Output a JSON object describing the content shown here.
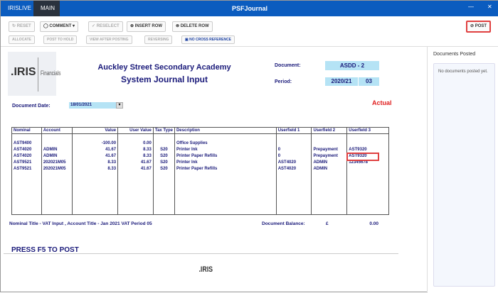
{
  "window": {
    "title": "PSFJournal",
    "tabs": [
      "IRISLIVE",
      "MAIN"
    ],
    "minimize": "—",
    "close": "✕"
  },
  "toolbar": {
    "row1": [
      {
        "label": "RESET",
        "icon": "reset-icon",
        "enabled": false
      },
      {
        "label": "COMMENT",
        "icon": "comment-icon",
        "enabled": true
      },
      {
        "label": "RESELECT",
        "icon": "reselect-icon",
        "enabled": false
      },
      {
        "label": "INSERT ROW",
        "icon": "plus-circle-icon",
        "enabled": true
      },
      {
        "label": "DELETE ROW",
        "icon": "x-circle-icon",
        "enabled": true
      }
    ],
    "row2": [
      {
        "label": "ALLOCATE",
        "enabled": false
      },
      {
        "label": "POST TO HOLD",
        "enabled": false
      },
      {
        "label": "VIEW AFTER POSTING",
        "enabled": false
      },
      {
        "label": "REVERSING",
        "enabled": false
      },
      {
        "label": "NO CROSS REFERENCE",
        "enabled": true
      }
    ],
    "post": "POST"
  },
  "header": {
    "org": "Auckley Street Secondary Academy",
    "title": "System Journal Input",
    "logo": "IRIS Financials",
    "document_label": "Document:",
    "document": "ASDD - 2",
    "period_label": "Period:",
    "period_year": "2020/21",
    "period_no": "03",
    "date_label": "Document Date:",
    "date": "18/01/2021",
    "type": "Actual"
  },
  "table": {
    "columns": [
      "Nominal",
      "Account",
      "Value",
      "User Value",
      "Tax Type",
      "Description",
      "Userfield 1",
      "Userfield 2",
      "Userfield 3"
    ],
    "rows": [
      [
        "AST9400",
        "",
        "-100.00",
        "0.00",
        "",
        "Office Supplies",
        "",
        "",
        ""
      ],
      [
        "AST4020",
        "ADMIN",
        "41.67",
        "8.33",
        "S20",
        "Printer Ink",
        "0",
        "Prepayment",
        "AST9320"
      ],
      [
        "AST4020",
        "ADMIN",
        "41.67",
        "8.33",
        "S20",
        "Printer Paper Refills",
        "0",
        "Prepayment",
        "AST9320"
      ],
      [
        "AST9521",
        "202021M05",
        "8.33",
        "41.67",
        "S20",
        "Printer Ink",
        "AST4020",
        "ADMIN",
        "12345678"
      ],
      [
        "AST9521",
        "202021M05",
        "8.33",
        "41.67",
        "S20",
        "Printer Paper Refills",
        "AST4020",
        "ADMIN",
        ""
      ]
    ]
  },
  "footer": {
    "titles": "Nominal Title - VAT Input , Account Title - Jan 2021 VAT Period 05",
    "balance_label": "Document Balance:",
    "currency": "£",
    "balance": "0.00",
    "hint": "PRESS F5 TO POST",
    "logo": "IRIS"
  },
  "side": {
    "title": "Documents Posted",
    "empty": "No documents posted yet."
  }
}
